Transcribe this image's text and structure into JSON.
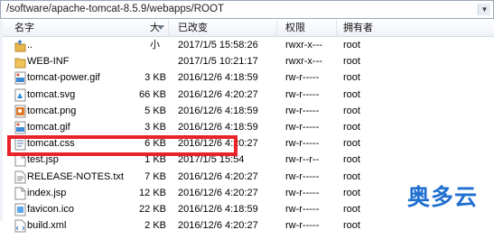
{
  "address_bar": {
    "path": "/software/apache-tomcat-8.5.9/webapps/ROOT"
  },
  "columns": {
    "name": "名字",
    "size": "大小",
    "modified": "已改变",
    "permissions": "权限",
    "owner": "拥有者"
  },
  "files": [
    {
      "icon": "parent-folder-icon",
      "name": "..",
      "size": "",
      "modified": "2017/1/5 15:58:26",
      "permissions": "rwxr-x---",
      "owner": "root"
    },
    {
      "icon": "folder-icon",
      "name": "WEB-INF",
      "size": "",
      "modified": "2017/1/5 10:21:17",
      "permissions": "rwxr-x---",
      "owner": "root"
    },
    {
      "icon": "gif-image-icon",
      "name": "tomcat-power.gif",
      "size": "3 KB",
      "modified": "2016/12/6 4:18:59",
      "permissions": "rw-r-----",
      "owner": "root"
    },
    {
      "icon": "svg-image-icon",
      "name": "tomcat.svg",
      "size": "66 KB",
      "modified": "2016/12/6 4:20:27",
      "permissions": "rw-r-----",
      "owner": "root"
    },
    {
      "icon": "png-image-icon",
      "name": "tomcat.png",
      "size": "5 KB",
      "modified": "2016/12/6 4:18:59",
      "permissions": "rw-r-----",
      "owner": "root"
    },
    {
      "icon": "gif-image-icon",
      "name": "tomcat.gif",
      "size": "3 KB",
      "modified": "2016/12/6 4:18:59",
      "permissions": "rw-r-----",
      "owner": "root"
    },
    {
      "icon": "css-file-icon",
      "name": "tomcat.css",
      "size": "6 KB",
      "modified": "2016/12/6 4:20:27",
      "permissions": "rw-r-----",
      "owner": "root"
    },
    {
      "icon": "jsp-file-icon",
      "name": "test.jsp",
      "size": "1 KB",
      "modified": "2017/1/5 15:54",
      "permissions": "rw-r--r--",
      "owner": "root"
    },
    {
      "icon": "text-file-icon",
      "name": "RELEASE-NOTES.txt",
      "size": "7 KB",
      "modified": "2016/12/6 4:20:27",
      "permissions": "rw-r-----",
      "owner": "root"
    },
    {
      "icon": "jsp-file-icon",
      "name": "index.jsp",
      "size": "12 KB",
      "modified": "2016/12/6 4:20:27",
      "permissions": "rw-r-----",
      "owner": "root"
    },
    {
      "icon": "ico-file-icon",
      "name": "favicon.ico",
      "size": "22 KB",
      "modified": "2016/12/6 4:18:59",
      "permissions": "rw-r-----",
      "owner": "root"
    },
    {
      "icon": "xml-file-icon",
      "name": "build.xml",
      "size": "2 KB",
      "modified": "2016/12/6 4:20:27",
      "permissions": "rw-r-----",
      "owner": "root"
    }
  ],
  "watermark": {
    "text": "奥多云"
  },
  "colors": {
    "highlight": "#e8232a",
    "watermark": "#1f6fd0",
    "folder": "#e8b64a"
  }
}
